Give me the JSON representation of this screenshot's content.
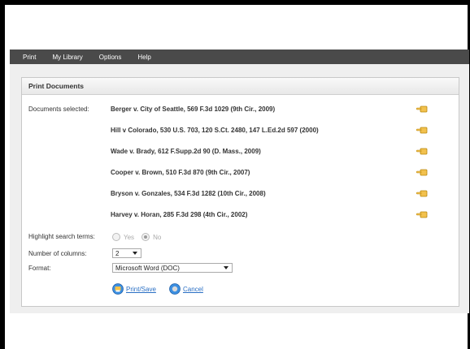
{
  "nav": {
    "items": [
      "Print",
      "My Library",
      "Options",
      "Help"
    ]
  },
  "panel": {
    "title": "Print Documents",
    "documents_label": "Documents selected:",
    "documents": [
      "Berger v. City of Seattle, 569 F.3d 1029 (9th Cir., 2009)",
      "Hill v Colorado, 530 U.S. 703, 120 S.Ct. 2480, 147 L.Ed.2d 597 (2000)",
      "Wade v. Brady, 612 F.Supp.2d 90 (D. Mass., 2009)",
      "Cooper v. Brown, 510 F.3d 870 (9th Cir., 2007)",
      "Bryson v. Gonzales, 534 F.3d 1282 (10th Cir., 2008)",
      "Harvey v. Horan, 285 F.3d 298 (4th Cir., 2002)"
    ],
    "highlight_label": "Highlight search terms:",
    "highlight_yes": "Yes",
    "highlight_no": "No",
    "columns_label": "Number of columns:",
    "columns_value": "2",
    "format_label": "Format:",
    "format_value": "Microsoft Word (DOC)",
    "print_save": "Print/Save",
    "cancel": "Cancel"
  },
  "colors": {
    "navbar": "#4a4a4a",
    "link": "#2a6fc4",
    "icon": "#e5a823"
  },
  "icons": {
    "document_remove": "hand-pointer-icon",
    "print_save": "print-save-icon",
    "cancel": "cancel-icon"
  }
}
